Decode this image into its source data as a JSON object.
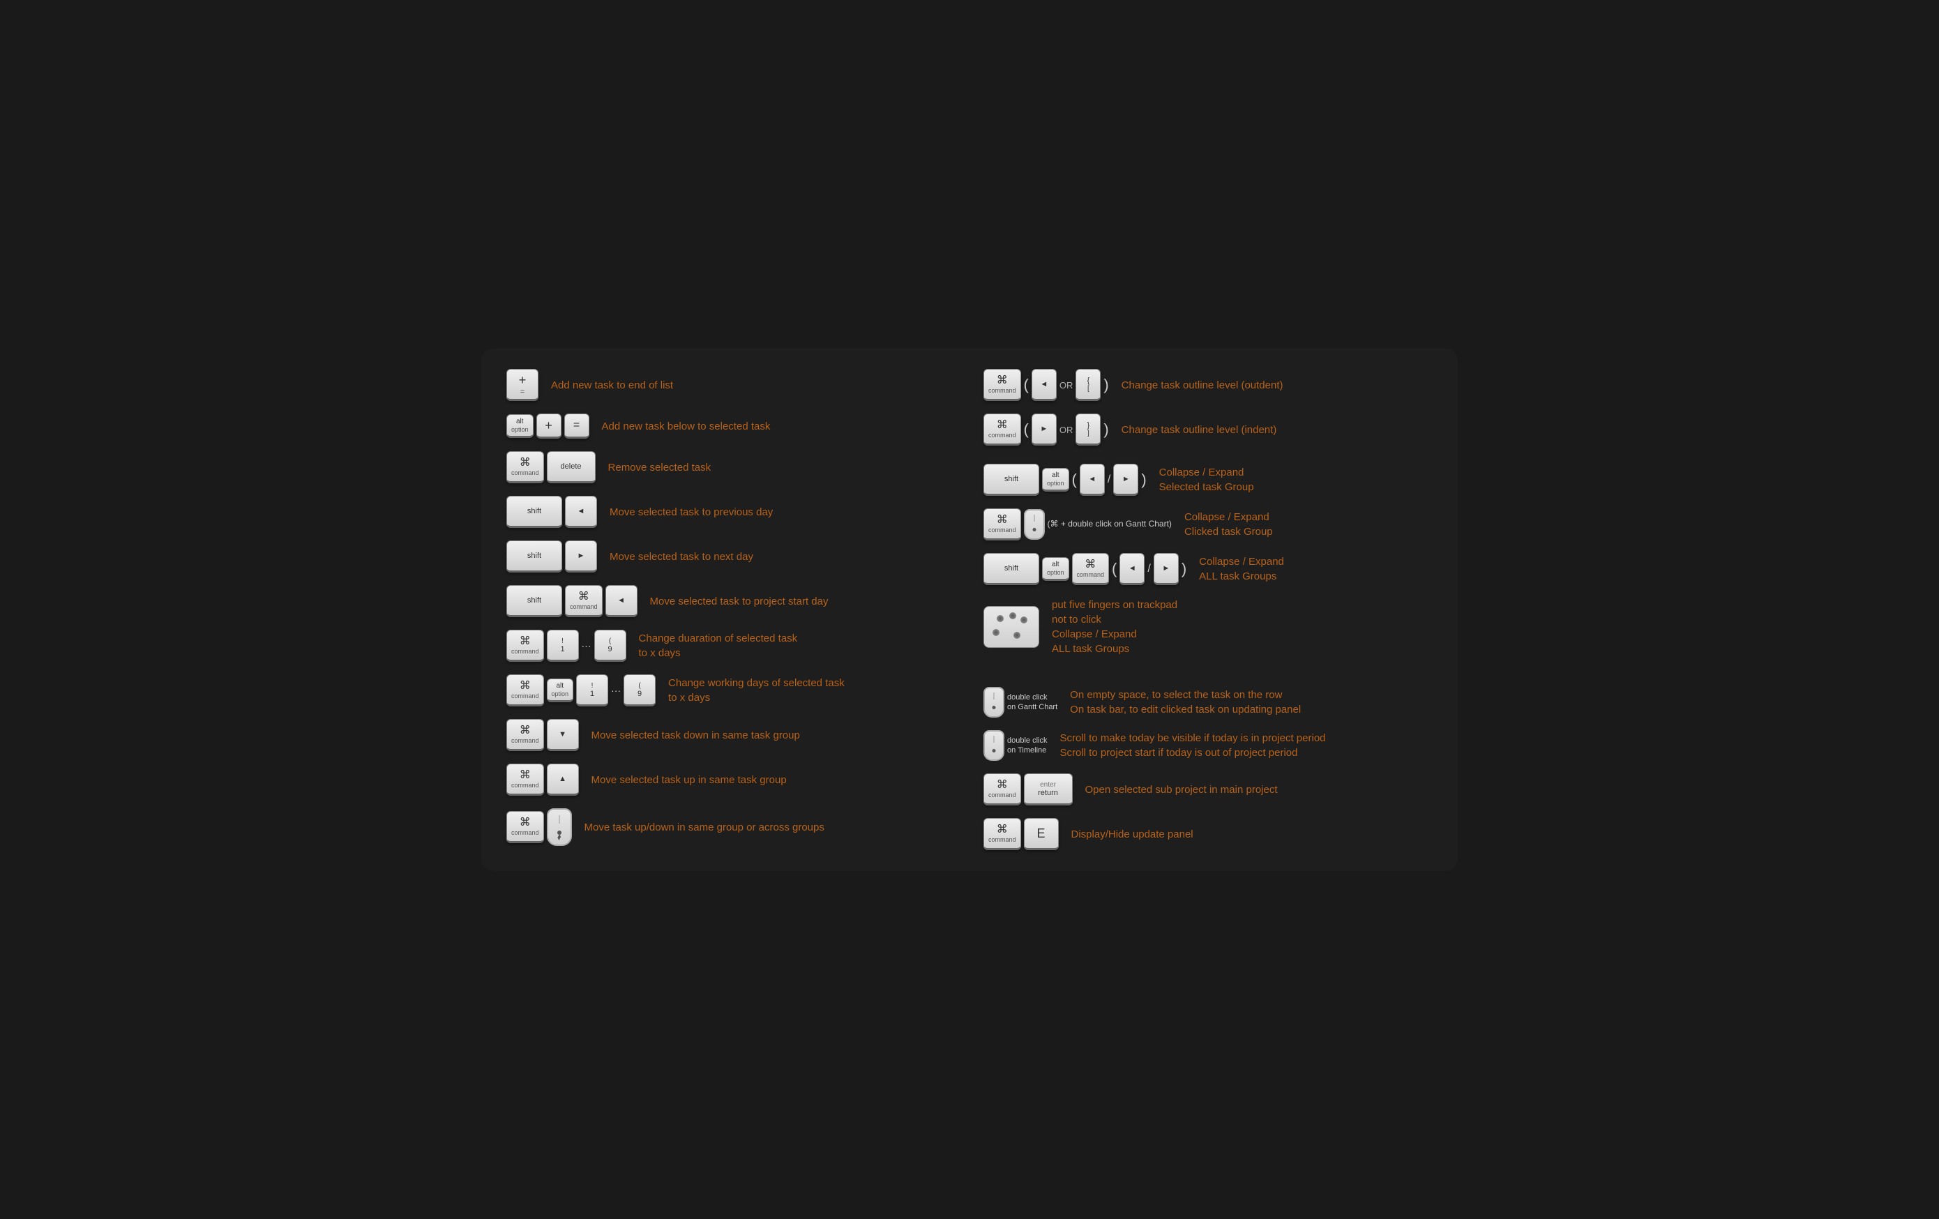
{
  "shortcuts": {
    "left": [
      {
        "id": "add-task-end",
        "keys": [
          {
            "symbol": "+",
            "label": "="
          },
          {
            "symbol": "",
            "label": ""
          }
        ],
        "keyDisplay": "plus-equals",
        "description": "Add new task to end of list"
      },
      {
        "id": "add-task-below",
        "keys": [
          {
            "symbol": "alt",
            "label": "option"
          },
          {
            "symbol": "+",
            "label": ""
          },
          {
            "symbol": "=",
            "label": ""
          }
        ],
        "description": "Add new task below to selected task"
      },
      {
        "id": "remove-task",
        "keys": [
          {
            "symbol": "⌘",
            "label": "command"
          },
          {
            "symbol": "delete",
            "label": ""
          }
        ],
        "description": "Remove selected task"
      },
      {
        "id": "move-prev-day",
        "keys": [
          {
            "symbol": "shift",
            "label": ""
          },
          {
            "symbol": "◄",
            "label": ""
          }
        ],
        "description": "Move selected task to previous day"
      },
      {
        "id": "move-next-day",
        "keys": [
          {
            "symbol": "shift",
            "label": ""
          },
          {
            "symbol": "►",
            "label": ""
          }
        ],
        "description": "Move selected task to next day"
      },
      {
        "id": "move-project-start",
        "keys": [
          {
            "symbol": "shift",
            "label": ""
          },
          {
            "symbol": "⌘",
            "label": "command"
          },
          {
            "symbol": "◄",
            "label": ""
          }
        ],
        "description": "Move selected task to project start day"
      },
      {
        "id": "change-duration",
        "keys": [
          {
            "symbol": "⌘",
            "label": "command"
          },
          {
            "symbol": "!",
            "label": "1"
          },
          {
            "symbol": "...",
            "label": ""
          },
          {
            "symbol": "(",
            "label": "9"
          }
        ],
        "description": "Change duaration of selected task\nto x days"
      },
      {
        "id": "change-working-days",
        "keys": [
          {
            "symbol": "⌘",
            "label": "command"
          },
          {
            "symbol": "alt",
            "label": "option"
          },
          {
            "symbol": "!",
            "label": "1"
          },
          {
            "symbol": "...",
            "label": ""
          },
          {
            "symbol": "(",
            "label": "9"
          }
        ],
        "description": "Change working days of selected task\nto x days"
      },
      {
        "id": "move-down",
        "keys": [
          {
            "symbol": "⌘",
            "label": "command"
          },
          {
            "symbol": "▼",
            "label": ""
          }
        ],
        "description": "Move selected task down in same task group"
      },
      {
        "id": "move-up",
        "keys": [
          {
            "symbol": "⌘",
            "label": "command"
          },
          {
            "symbol": "▲",
            "label": ""
          }
        ],
        "description": "Move selected task up in same task group"
      },
      {
        "id": "move-drag",
        "keys": [
          {
            "symbol": "⌘",
            "label": "command"
          },
          {
            "symbol": "mouse",
            "label": ""
          }
        ],
        "description": "Move task up/down in same group or across groups"
      }
    ],
    "right": [
      {
        "id": "outdent",
        "keys": [
          {
            "symbol": "⌘",
            "label": "command"
          }
        ],
        "extra": "( ◄ OR { [ )",
        "description": "Change task outline level (outdent)"
      },
      {
        "id": "indent",
        "keys": [
          {
            "symbol": "⌘",
            "label": "command"
          }
        ],
        "extra": "( ► OR } ] )",
        "description": "Change task outline level (indent)"
      },
      {
        "id": "collapse-expand-selected",
        "keys": [
          {
            "symbol": "shift",
            "label": ""
          },
          {
            "symbol": "alt",
            "label": "option"
          }
        ],
        "extra": "( ◄ / ► )",
        "description": "Collapse / Expand\nSelected task Group"
      },
      {
        "id": "collapse-expand-clicked",
        "keys": [
          {
            "symbol": "⌘",
            "label": "command"
          },
          {
            "symbol": "mouse",
            "label": ""
          }
        ],
        "extra": "(⌘ + double click on Gantt Chart)",
        "description": "Collapse / Expand\nClicked task Group"
      },
      {
        "id": "collapse-expand-all",
        "keys": [
          {
            "symbol": "shift",
            "label": ""
          },
          {
            "symbol": "alt",
            "label": "option"
          },
          {
            "symbol": "⌘",
            "label": "command"
          }
        ],
        "extra": "( ◄ / ► )",
        "description": "Collapse / Expand\nALL task Groups"
      },
      {
        "id": "trackpad-collapse",
        "extra": "put five fingers on trackpad\nnot to click",
        "description": "Collapse / Expand\nALL task Groups"
      },
      {
        "id": "double-click-gantt",
        "mouseLabel": "double click\non Gantt Chart",
        "description": "On empty space, to select the task on the row\nOn task bar, to edit clicked task on updating panel"
      },
      {
        "id": "double-click-timeline",
        "mouseLabel": "double click\non Timeline",
        "description": "Scroll to make today be visible if today is in project period\nScroll to project start if today is out of project period"
      },
      {
        "id": "open-subproject",
        "keys": [
          {
            "symbol": "⌘",
            "label": "command"
          },
          {
            "symbol": "enter",
            "label": "return"
          }
        ],
        "description": "Open selected sub project in main project"
      },
      {
        "id": "display-hide-panel",
        "keys": [
          {
            "symbol": "⌘",
            "label": "command"
          },
          {
            "symbol": "E",
            "label": ""
          }
        ],
        "description": "Display/Hide update panel"
      }
    ]
  }
}
